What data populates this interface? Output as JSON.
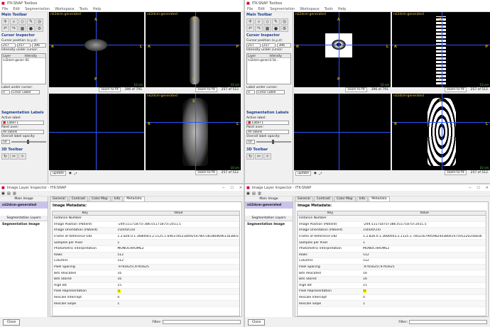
{
  "snap": {
    "window_title": "ITK-SNAP Toolbox",
    "menu": [
      "File",
      "Edit",
      "Segmentation",
      "Workspace",
      "Tools",
      "Help"
    ],
    "main_toolbar": "Main Toolbar",
    "cursor_inspector": "Cursor Inspector",
    "cursor_position_label": "Cursor position (x,y,z):",
    "cursor_x": "257",
    "cursor_y": "257",
    "cursor_z": "396",
    "intensity_label": "Intensity under cursor:",
    "col_layer": "Layer",
    "col_intensity": "Intensity",
    "layer_name": "nii2dcm-genera…",
    "left_intensity": "-81",
    "right_intensity": "0.5d…",
    "label_under_cursor": "Label under cursor:",
    "label_value": "0",
    "label_name": "Clear Label",
    "seg_labels": "Segmentation Labels",
    "active_label": "Active label:",
    "active_label_value": "Label 1",
    "paint_over": "Paint over:",
    "paint_over_value": "All labels",
    "opacity_label": "Overall label opacity:",
    "opacity_value": "50",
    "toolbar_3d": "3D Toolbar",
    "view_label": "nii2dcm-generated",
    "zoom_to_fit": "zoom to fit",
    "slice_axial": "396 of 791",
    "slice_sagittal": "257 of 512",
    "slice_coronal": "257 of 512",
    "scale": "10 cm",
    "update": "update",
    "orient": {
      "A": "A",
      "P": "P",
      "R": "R",
      "L": "L",
      "S": "S",
      "I": "I"
    }
  },
  "inspector": {
    "window_title": "Image Layer Inspector - ITK-SNAP",
    "main_image_group": "Main Image",
    "selected_layer": "nii2dcm-generated",
    "seg_layers_group": "Segmentation Layers",
    "seg_image": "Segmentation Image",
    "tabs": [
      "General",
      "Contrast",
      "Color Map",
      "Info",
      "Metadata"
    ],
    "metadata_title": "Image Metadata:",
    "col_key": "Key",
    "col_value": "Value",
    "close": "Close",
    "filter": "Filter:",
    "rows_keys": [
      "Instance Number",
      "Image Position (Patient)",
      "Image Orientation (Patient)",
      "Frame of Reference UID",
      "Samples per Pixel",
      "Photometric Interpretation",
      "Rows",
      "Columns",
      "Pixel Spacing",
      "Bits Allocated",
      "Bits Stored",
      "High Bit",
      "Pixel Representation",
      "Rescale Intercept",
      "Rescale Slope"
    ],
    "left_values": [
      "",
      "-249.51171875\\-386.01171875\\-2011.5",
      "1\\0\\0\\0\\1\\0",
      "1.2.826.0.1.3680043.2.1125.1.64637852184925478072818696961163803",
      "1",
      "MONOCHROME2",
      "512",
      "512",
      ".9765625\\.9765625",
      "16",
      "16",
      "15",
      "1",
      "0",
      "1"
    ],
    "right_values": [
      "",
      "-249.51171875\\-386.01171875\\-2011.5",
      "1\\0\\0\\0\\1\\0",
      "1.2.826.0.1.3680043.2.1125.1.7852167995982443800147591220256836",
      "1",
      "MONOCHROME2",
      "512",
      "512",
      ".9765625\\.9765625",
      "16",
      "16",
      "15",
      "0",
      "0",
      "1"
    ]
  },
  "colors": {
    "accent": "#1a3d8f",
    "highlight": "#fff200",
    "selected": "#c9c3ec",
    "orient": "#d4a800",
    "crosshair": "#2a55ff"
  }
}
